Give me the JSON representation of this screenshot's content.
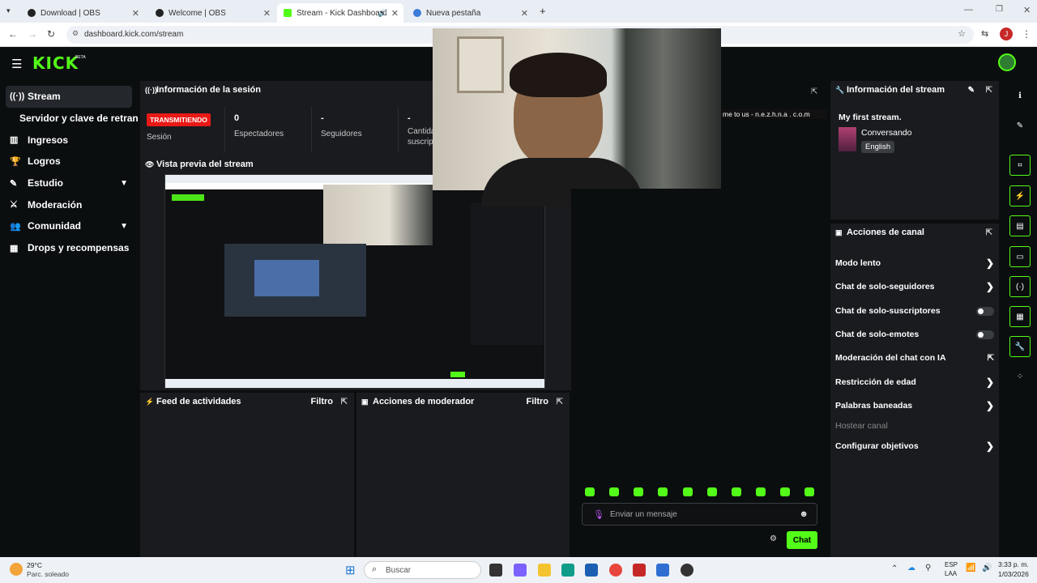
{
  "browser": {
    "tabs": [
      {
        "title": "Download | OBS",
        "color": "#222222"
      },
      {
        "title": "Welcome | OBS",
        "color": "#222222"
      },
      {
        "title": "Stream - Kick Dashboard",
        "color": "#53fc18"
      },
      {
        "title": "Nueva pestaña",
        "color": "#3b7cd9"
      }
    ],
    "url": "dashboard.kick.com/stream",
    "profile_initial": "J"
  },
  "app": {
    "logo": "KICK",
    "beta": "BETA"
  },
  "sidebar": {
    "items": [
      {
        "label": "Stream",
        "icon": "broadcast-icon"
      },
      {
        "label": "Servidor y clave de retransmisión",
        "icon": ""
      },
      {
        "label": "Ingresos",
        "icon": "chart-icon"
      },
      {
        "label": "Logros",
        "icon": "trophy-icon"
      },
      {
        "label": "Estudio",
        "icon": "pencil-icon"
      },
      {
        "label": "Moderación",
        "icon": "sword-icon"
      },
      {
        "label": "Comunidad",
        "icon": "users-icon"
      },
      {
        "label": "Drops y recompensas",
        "icon": "gift-icon"
      }
    ]
  },
  "session": {
    "title": "Información de la sesión",
    "live_badge": "TRANSMITIENDO",
    "session_label": "Sesión",
    "stats": [
      {
        "value": "0",
        "label": "Espectadores"
      },
      {
        "value": "-",
        "label": "Seguidores"
      },
      {
        "value": "-",
        "label": "Cantidad suscrip"
      }
    ]
  },
  "preview": {
    "title": "Vista previa del stream"
  },
  "webcam_overlay_text": "me to us - n.e.z.h.n.a . c.o.m",
  "activity_feed": {
    "title": "Feed de actividades",
    "filter": "Filtro"
  },
  "mod_actions": {
    "title": "Acciones de moderador",
    "filter": "Filtro"
  },
  "chat": {
    "placeholder": "Enviar un mensaje",
    "send_label": "Chat"
  },
  "stream_info": {
    "title": "Información del stream",
    "stream_title": "My first stream.",
    "category": "Conversando",
    "language": "English"
  },
  "channel_actions": {
    "title": "Acciones de canal",
    "items": [
      {
        "label": "Modo lento",
        "control": "arrow"
      },
      {
        "label": "Chat de solo-seguidores",
        "control": "arrow"
      },
      {
        "label": "Chat de solo-suscriptores",
        "control": "toggle"
      },
      {
        "label": "Chat de solo-emotes",
        "control": "toggle"
      },
      {
        "label": "Moderación del chat con IA",
        "control": "popout"
      },
      {
        "label": "Restricción de edad",
        "control": "arrow"
      },
      {
        "label": "Palabras baneadas",
        "control": "arrow"
      },
      {
        "label": "Hostear canal",
        "control": "none"
      },
      {
        "label": "Configurar objetivos",
        "control": "arrow"
      }
    ]
  },
  "taskbar": {
    "weather_temp": "29°C",
    "weather_desc": "Parc. soleado",
    "search_placeholder": "Buscar",
    "lang": "ESP",
    "lang2": "LAA",
    "time": "3:33 p. m.",
    "date": "1/03/2026"
  },
  "accent_color": "#53fc18",
  "live_color": "#e91916"
}
